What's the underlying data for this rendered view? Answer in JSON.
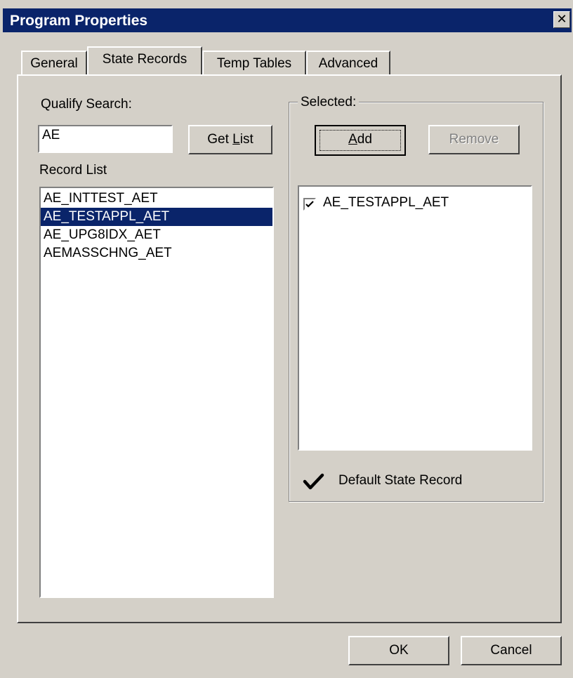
{
  "window": {
    "title": "Program Properties",
    "close_glyph": "✕"
  },
  "tabs": [
    {
      "label": "General",
      "active": false
    },
    {
      "label": "State Records",
      "active": true
    },
    {
      "label": "Temp Tables",
      "active": false
    },
    {
      "label": "Advanced",
      "active": false
    }
  ],
  "search": {
    "label": "Qualify Search:",
    "value": "AE",
    "get_list_prefix": "Get ",
    "get_list_accel": "L",
    "get_list_suffix": "ist"
  },
  "record_list": {
    "label": "Record List",
    "items": [
      "AE_INTTEST_AET",
      "AE_TESTAPPL_AET",
      "AE_UPG8IDX_AET",
      "AEMASSCHNG_AET"
    ],
    "selected_index": 1
  },
  "selected": {
    "label": "Selected:",
    "add_accel": "A",
    "add_suffix": "dd",
    "remove_label": "Remove",
    "items": [
      {
        "label": "AE_TESTAPPL_AET",
        "checked": true
      }
    ],
    "default_state_label": "Default State Record"
  },
  "footer": {
    "ok_label": "OK",
    "cancel_label": "Cancel"
  },
  "colors": {
    "titlebar": "#0a246a",
    "face": "#d4d0c8",
    "selection": "#0a246a"
  },
  "icons": {
    "default_marker": "checkmark-icon"
  }
}
